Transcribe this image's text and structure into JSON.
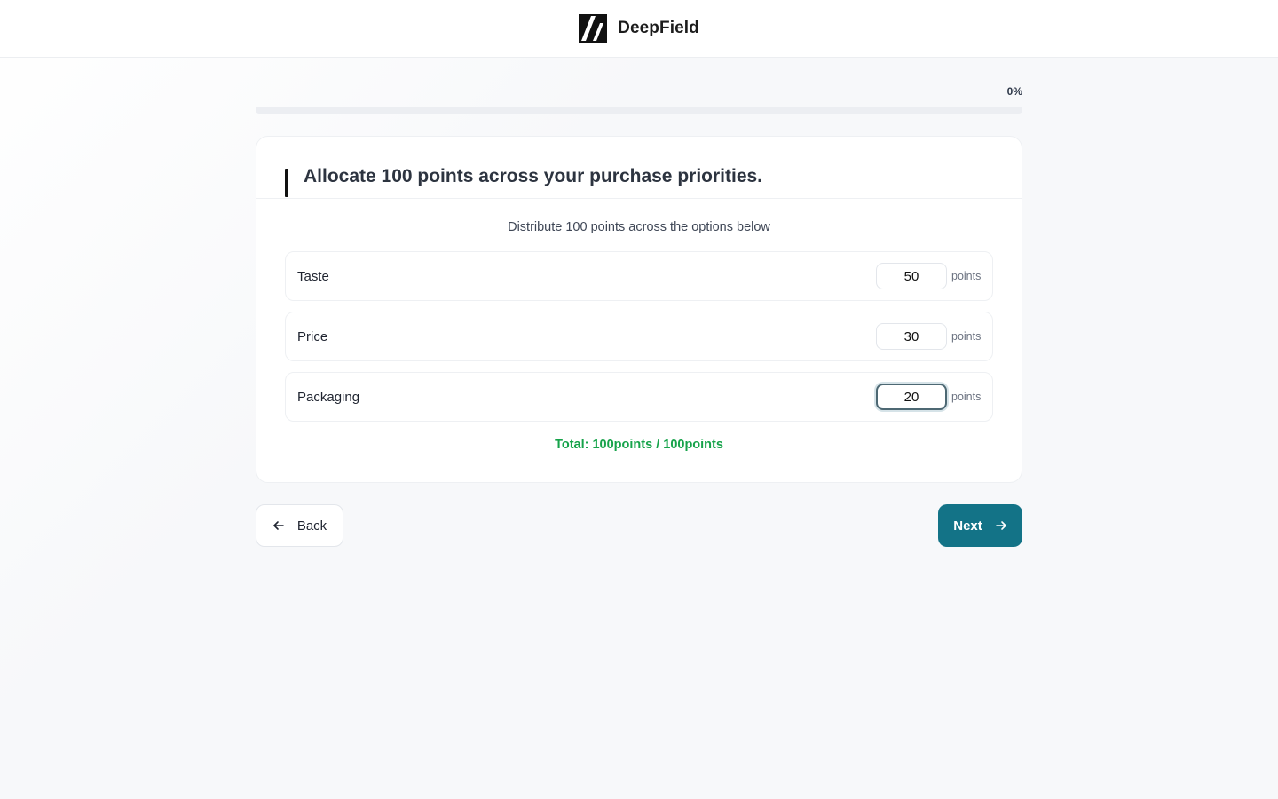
{
  "brand": {
    "name": "DeepField",
    "logo_icon": "slash-logo-icon"
  },
  "progress": {
    "label": "0%",
    "value": 0
  },
  "question": {
    "title": "Allocate 100 points across your purchase priorities.",
    "instruction": "Distribute 100 points across the options below",
    "unit_label": "points",
    "options": [
      {
        "label": "Taste",
        "value": "50"
      },
      {
        "label": "Price",
        "value": "30"
      },
      {
        "label": "Packaging",
        "value": "20"
      }
    ],
    "total_text": "Total: 100points / 100points"
  },
  "nav": {
    "back_label": "Back",
    "next_label": "Next",
    "back_icon": "arrow-left-icon",
    "next_icon": "arrow-right-icon"
  },
  "colors": {
    "accent": "#137387",
    "success": "#16a34a",
    "brand_dark": "#111111"
  }
}
